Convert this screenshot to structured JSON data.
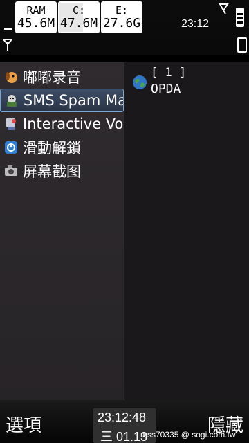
{
  "status_bar": {
    "memory": [
      {
        "label": "RAM",
        "value": "45.6M",
        "fill": 0.0
      },
      {
        "label": "C:",
        "value": "47.6M",
        "fill": 0.6
      },
      {
        "label": "E:",
        "value": "27.6G",
        "fill": 0.0
      }
    ],
    "time": "23:12"
  },
  "app_list": {
    "items": [
      {
        "label": "嘟嘟录音",
        "icon": "dog-icon",
        "selected": false
      },
      {
        "label": "SMS Spam Ma",
        "icon": "spam-manager-icon",
        "selected": true
      },
      {
        "label": "Interactive Vo",
        "icon": "voice-icon",
        "selected": false
      },
      {
        "label": "滑動解鎖",
        "icon": "unlock-icon",
        "selected": false
      },
      {
        "label": "屏幕截图",
        "icon": "camera-icon",
        "selected": false
      }
    ]
  },
  "detail": {
    "count": "[ 1 ]",
    "name": "OPDA"
  },
  "softkeys": {
    "left": "選項",
    "right": "隱藏"
  },
  "clock": {
    "time": "23:12:48",
    "date": "三 01.13"
  },
  "watermark": "mss70335 @ sogi.com.tw",
  "colors": {
    "selection_border": "#7aa6d6",
    "list_background": "#2f2b2f"
  }
}
